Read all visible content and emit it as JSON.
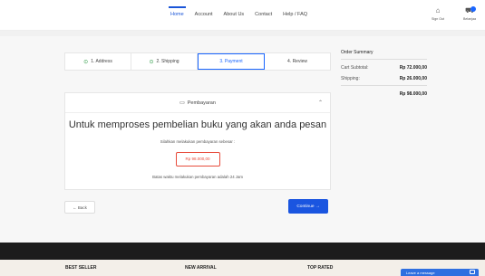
{
  "nav": {
    "items": [
      {
        "label": "Home",
        "active": true
      },
      {
        "label": "Account",
        "active": false
      },
      {
        "label": "About Us",
        "active": false
      },
      {
        "label": "Contact",
        "active": false
      },
      {
        "label": "Help / FAQ",
        "active": false
      }
    ]
  },
  "header_icons": {
    "user": {
      "glyph": "⌂",
      "label": "Sign Out"
    },
    "cart": {
      "glyph": "⛟",
      "label": "Belanjaa"
    }
  },
  "steps": [
    {
      "label": "1. Address",
      "done": true
    },
    {
      "label": "2. Shipping",
      "done": true
    },
    {
      "label": "3. Payment",
      "active": true
    },
    {
      "label": "4. Review",
      "active": false
    }
  ],
  "step_check_glyph": "⊙",
  "summary": {
    "title": "Order Summary",
    "subtotal_label": "Cart Subtotal:",
    "subtotal_value": "Rp 72.000,00",
    "shipping_label": "Shipping:",
    "shipping_value": "Rp 26.000,00",
    "total_value": "Rp 98.000,00"
  },
  "payment": {
    "header_label": "Pembayaran",
    "wallet_glyph": "▭",
    "chevron_glyph": "⌃",
    "headline": "Untuk memproses pembelian buku yang akan anda pesan",
    "instruction": "Silahkan melakukan pembayaran sebesar :",
    "amount": "Rp 98.000,00",
    "deadline": "Batas waktu melakukan pembayaran adalah 24 Jam"
  },
  "buttons": {
    "back": "← Back",
    "continue": "Continue →"
  },
  "footer": {
    "col1": "BEST SELLER",
    "col2": "NEW ARRIVAL",
    "col3": "TOP RATED"
  },
  "chat": {
    "label": "Leave a message"
  },
  "colors": {
    "accent": "#1a55d8",
    "amount_red": "#e74c3c",
    "check_green": "#2e9b46"
  }
}
